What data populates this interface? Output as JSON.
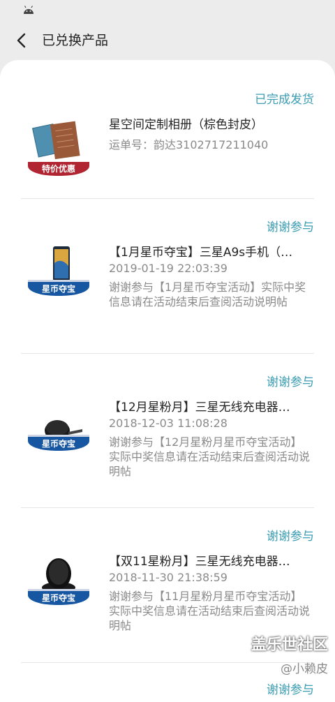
{
  "header": {
    "title": "已兑换产品"
  },
  "orders": [
    {
      "status": "已完成发货",
      "name": "星空间定制相册（棕色封皮）",
      "tracking": "运单号：韵达3102717211040",
      "badge": "特价优惠"
    },
    {
      "status": "谢谢参与",
      "name": "【1月星币夺宝】三星A9s手机（…",
      "date": "2019-01-19 22:03:39",
      "desc": "谢谢参与【1月星币夺宝活动】实际中奖信息请在活动结束后查阅活动说明帖",
      "badge": "星币夺宝"
    },
    {
      "status": "谢谢参与",
      "name": "【12月星粉月】三星无线充电器…",
      "date": "2018-12-03 11:08:28",
      "desc": "谢谢参与【12月星粉月星币夺宝活动】实际中奖信息请在活动结束后查阅活动说明帖",
      "badge": "星币夺宝"
    },
    {
      "status": "谢谢参与",
      "name": "【双11星粉月】三星无线充电器…",
      "date": "2018-11-30 21:38:59",
      "desc": "谢谢参与【11月星粉月星币夺宝活动】实际中奖信息请在活动结束后查阅活动说明帖",
      "badge": "星币夺宝"
    }
  ],
  "peek": {
    "status": "谢谢参与"
  },
  "watermark": {
    "title": "盖乐世社区",
    "user": "@小赖皮"
  },
  "colors": {
    "accent": "#3b9db3",
    "badge_red": "#b02531",
    "badge_blue": "#1756a0"
  }
}
